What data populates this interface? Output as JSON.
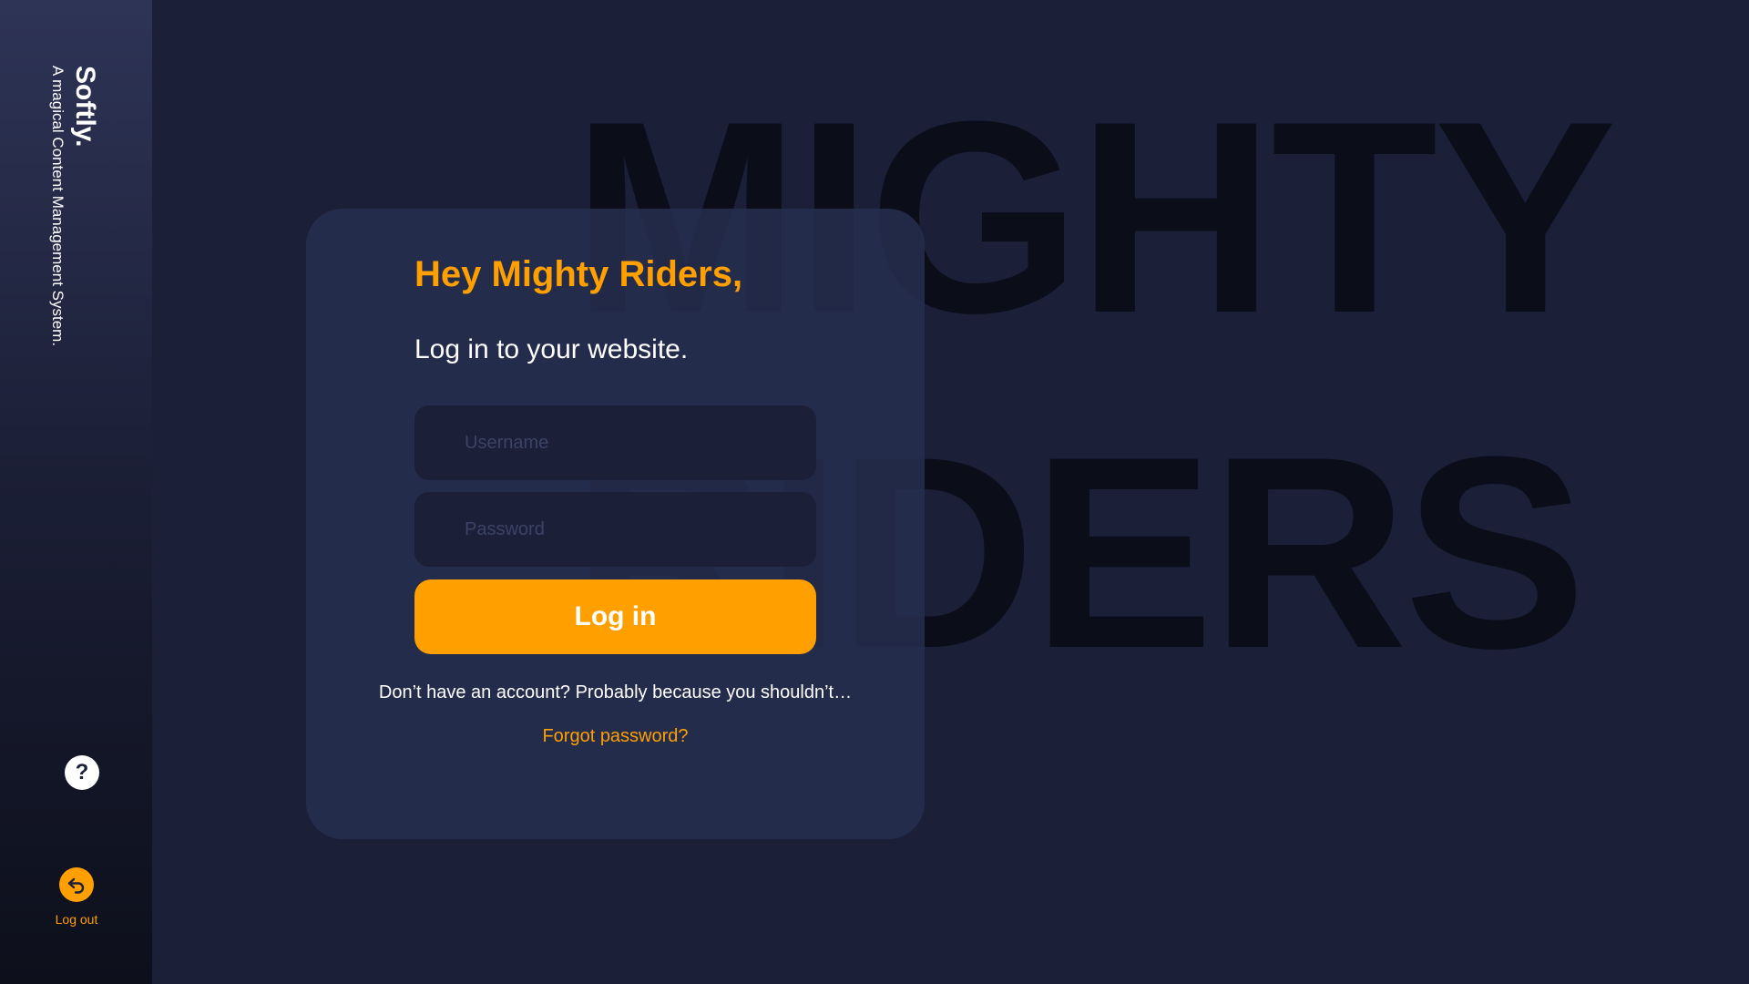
{
  "sidebar": {
    "brand_name": "Softly.",
    "tagline": "A magical Content Management System.",
    "help_label": "?",
    "help_icon": "question-icon",
    "logout_icon": "logout-arrow-icon",
    "logout_label": "Log out"
  },
  "background_text": {
    "line1": "MIGHTY",
    "line2": "RIDERS"
  },
  "login": {
    "greeting": "Hey Mighty Riders,",
    "subtitle": "Log in to your website.",
    "username": {
      "value": "",
      "placeholder": "Username"
    },
    "password": {
      "value": "",
      "placeholder": "Password"
    },
    "submit_label": "Log in",
    "no_account_text": "Don’t have an account? Probably because you shouldn’t…",
    "forgot_label": "Forgot password?"
  },
  "colors": {
    "accent": "#ff9f00",
    "background": "#1b1f38",
    "card": "#272e4e",
    "sidebar_top": "#2e3456",
    "sidebar_bottom": "#0d0f1b"
  }
}
